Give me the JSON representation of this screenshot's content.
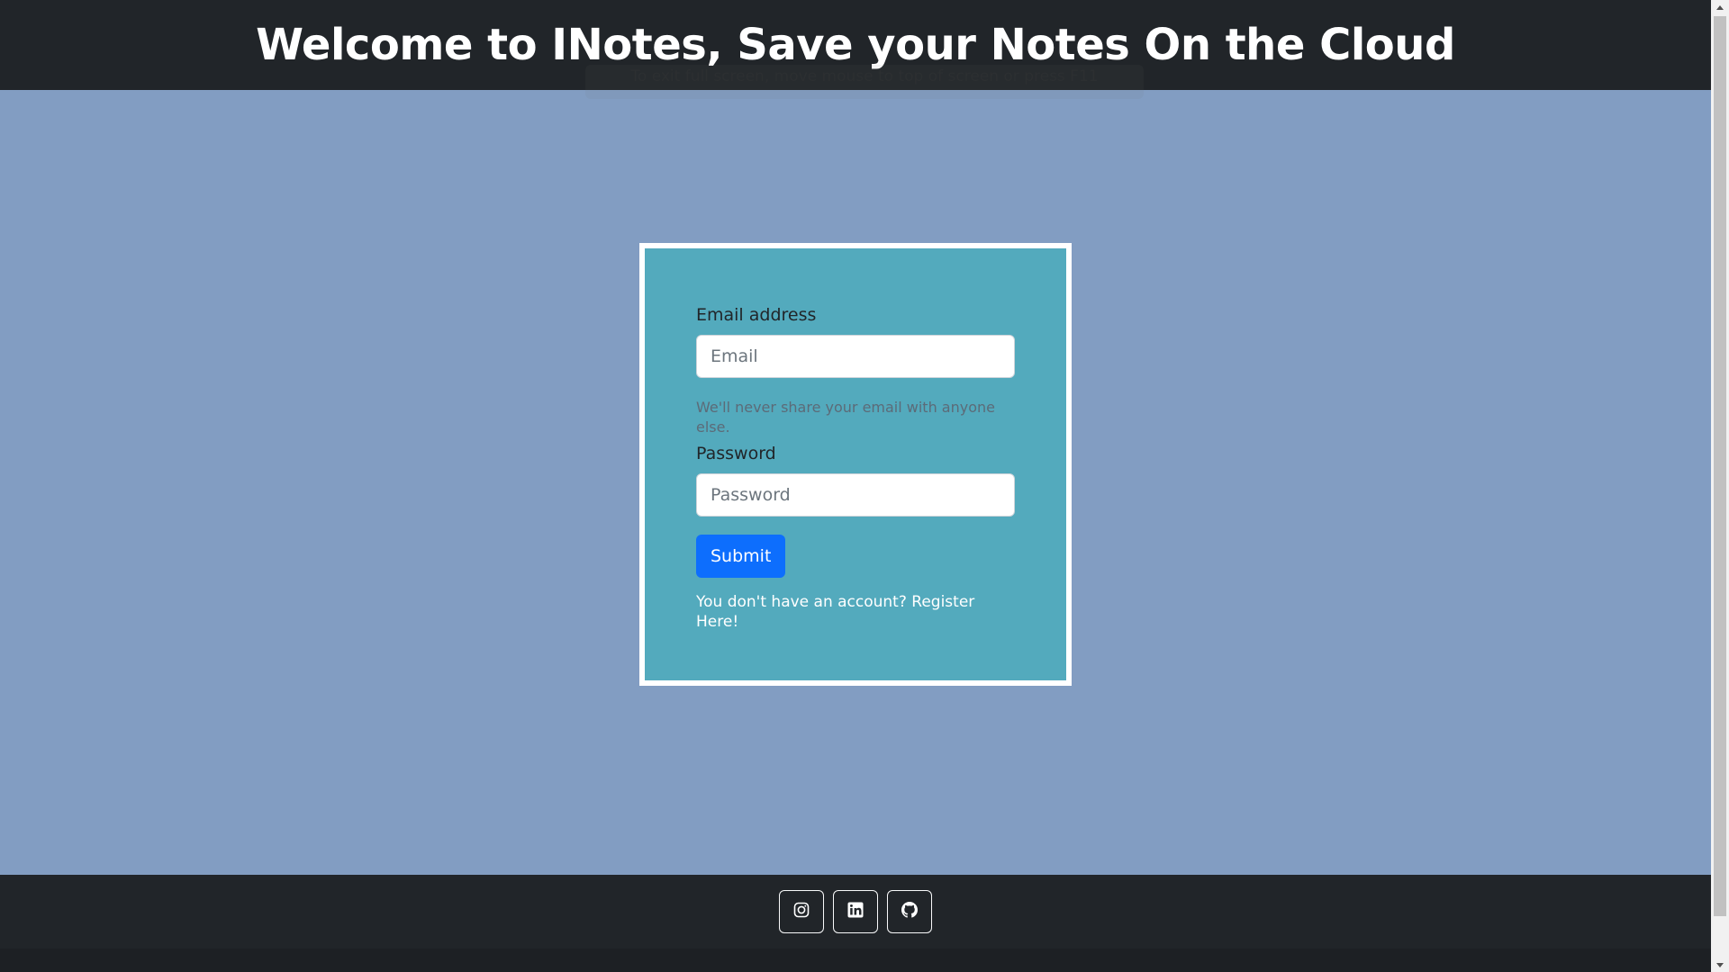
{
  "header": {
    "title": "Welcome to INotes, Save your Notes On the Cloud"
  },
  "overlay": {
    "fullscreen_hint": "To exit full screen, move mouse to top of screen or press F11"
  },
  "login_form": {
    "email_label": "Email address",
    "email_placeholder": "Email",
    "email_help": "We'll never share your email with anyone else.",
    "password_label": "Password",
    "password_placeholder": "Password",
    "submit_label": "Submit",
    "register_prompt": "You don't have an account?",
    "register_link": "Register Here!"
  },
  "footer": {
    "icons": [
      "instagram-icon",
      "linkedin-icon",
      "github-icon"
    ]
  },
  "colors": {
    "header_bg": "#212529",
    "page_bg": "#829dc2",
    "card_bg": "#53aabd",
    "button_bg": "#0d6efd"
  }
}
